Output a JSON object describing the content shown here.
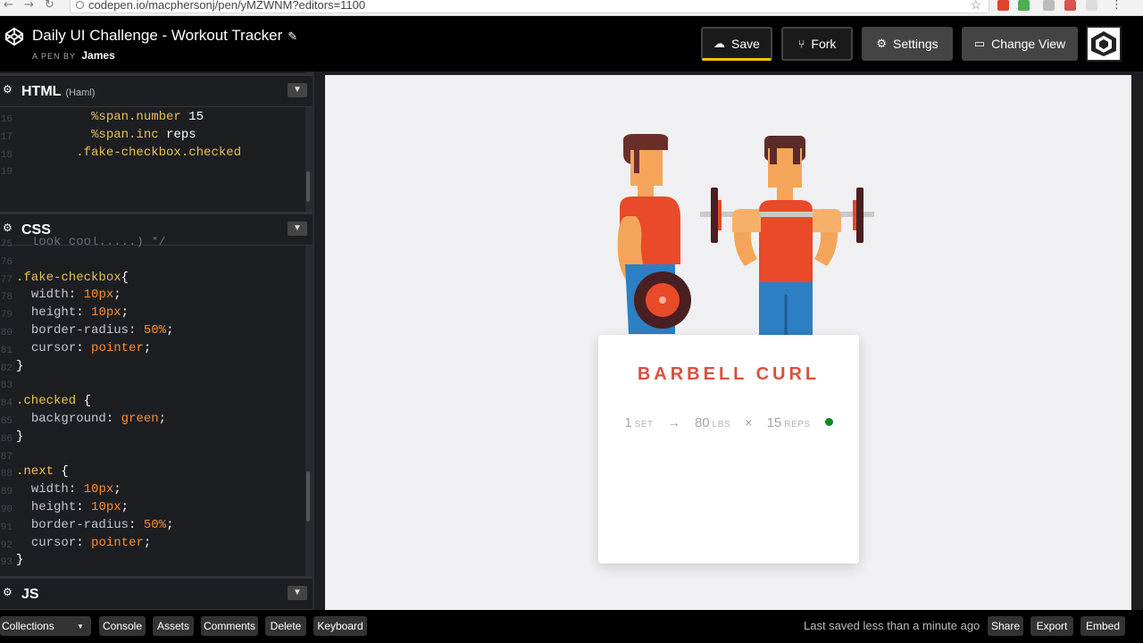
{
  "browser": {
    "url": "codepen.io/macphersonj/pen/yMZWNM?editors=1100",
    "back": "←",
    "forward": "→",
    "reload": "↻"
  },
  "header": {
    "title": "Daily UI Challenge - Workout Tracker",
    "byline_prefix": "A PEN BY",
    "author": "James",
    "buttons": {
      "save": "Save",
      "fork": "Fork",
      "settings": "Settings",
      "change_view": "Change View"
    }
  },
  "editors": {
    "html": {
      "name": "HTML",
      "sub": "(Haml)",
      "lines": [
        {
          "n": "16",
          "code": "          %span.number 15"
        },
        {
          "n": "17",
          "code": "          %span.inc reps"
        },
        {
          "n": "18",
          "code": "        .fake-checkbox.checked"
        },
        {
          "n": "19",
          "code": ""
        }
      ]
    },
    "css": {
      "name": "CSS",
      "lines": [
        {
          "n": "75",
          "code": "  look cool.....) */"
        },
        {
          "n": "76",
          "code": ""
        },
        {
          "n": "77",
          "code": ".fake-checkbox{"
        },
        {
          "n": "78",
          "code": "  width: 10px;"
        },
        {
          "n": "79",
          "code": "  height: 10px;"
        },
        {
          "n": "80",
          "code": "  border-radius: 50%;"
        },
        {
          "n": "81",
          "code": "  cursor: pointer;"
        },
        {
          "n": "82",
          "code": "}"
        },
        {
          "n": "83",
          "code": ""
        },
        {
          "n": "84",
          "code": ".checked {"
        },
        {
          "n": "85",
          "code": "  background: green;"
        },
        {
          "n": "86",
          "code": "}"
        },
        {
          "n": "87",
          "code": ""
        },
        {
          "n": "88",
          "code": ".next {"
        },
        {
          "n": "89",
          "code": "  width: 10px;"
        },
        {
          "n": "90",
          "code": "  height: 10px;"
        },
        {
          "n": "91",
          "code": "  border-radius: 50%;"
        },
        {
          "n": "92",
          "code": "  cursor: pointer;"
        },
        {
          "n": "93",
          "code": "}"
        }
      ]
    },
    "js": {
      "name": "JS"
    }
  },
  "preview": {
    "exercise": "BARBELL CURL",
    "sets": "1",
    "sets_unit": "SET",
    "arrow": "→",
    "weight": "80",
    "weight_unit": "LBS",
    "times": "×",
    "reps": "15",
    "reps_unit": "REPS",
    "done_color": "#118a1e"
  },
  "bottom": {
    "collections": "Collections",
    "console": "Console",
    "assets": "Assets",
    "comments": "Comments",
    "delete": "Delete",
    "keyboard": "Keyboard",
    "status": "Last saved less than a minute ago",
    "share": "Share",
    "export": "Export",
    "embed": "Embed"
  },
  "colors": {
    "accent_title": "#d9503f",
    "save_underline": "#f1c40f"
  }
}
